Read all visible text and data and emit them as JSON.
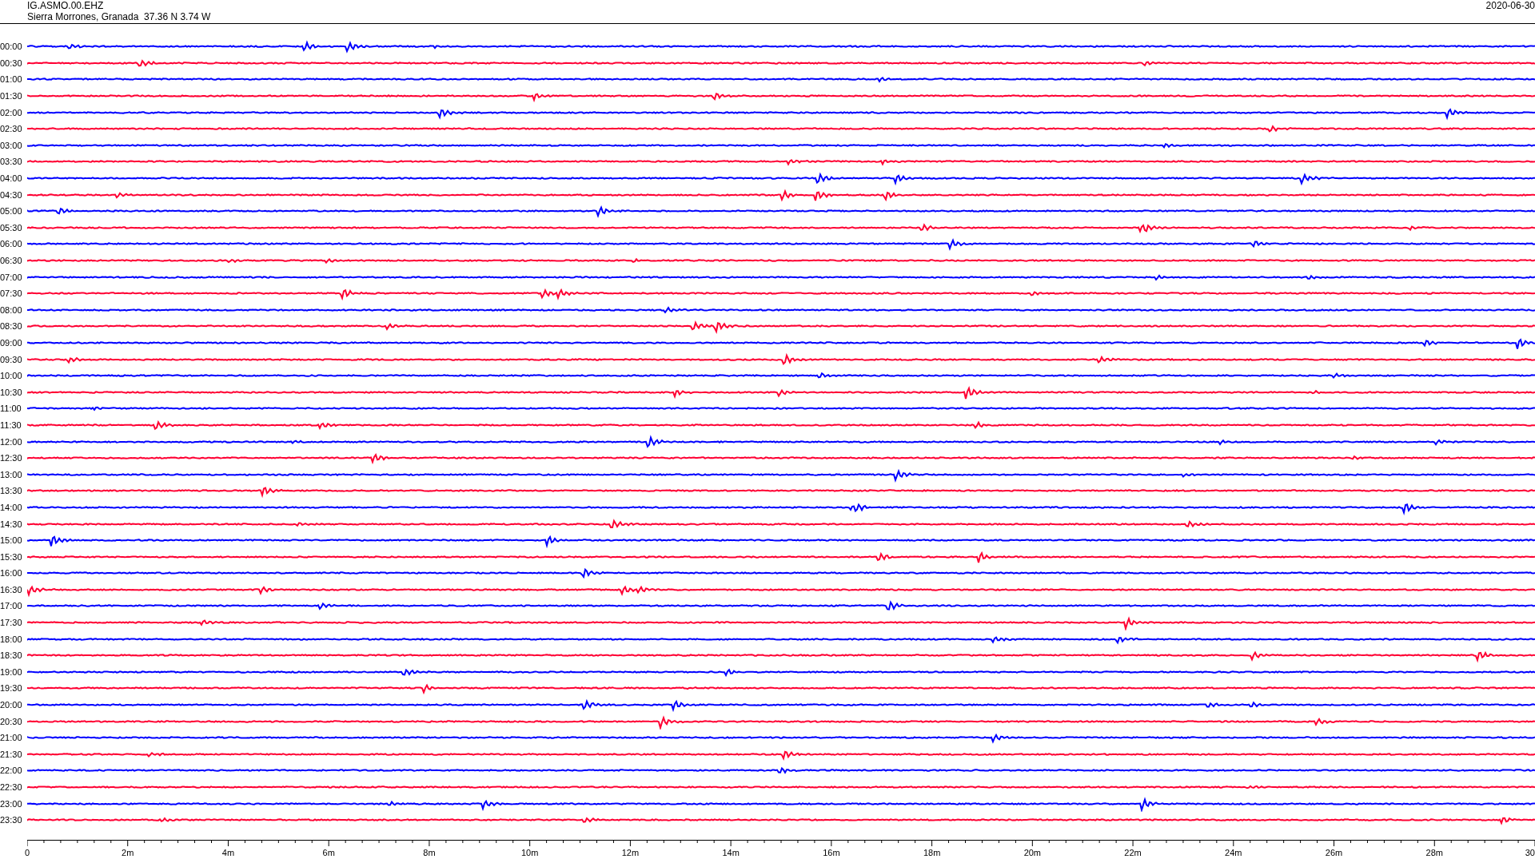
{
  "header": {
    "station": "IG.ASMO.00.EHZ",
    "location": "Sierra Morrones, Granada  37.36 N 3.74 W",
    "date": "2020-06-30"
  },
  "rows": [
    {
      "time": "00:00",
      "color": "#0000ff"
    },
    {
      "time": "00:30",
      "color": "#ff0033"
    },
    {
      "time": "01:00",
      "color": "#0000ff"
    },
    {
      "time": "01:30",
      "color": "#ff0033"
    },
    {
      "time": "02:00",
      "color": "#0000ff"
    },
    {
      "time": "02:30",
      "color": "#ff0033"
    },
    {
      "time": "03:00",
      "color": "#0000ff"
    },
    {
      "time": "03:30",
      "color": "#ff0033"
    },
    {
      "time": "04:00",
      "color": "#0000ff"
    },
    {
      "time": "04:30",
      "color": "#ff0033"
    },
    {
      "time": "05:00",
      "color": "#0000ff"
    },
    {
      "time": "05:30",
      "color": "#ff0033"
    },
    {
      "time": "06:00",
      "color": "#0000ff"
    },
    {
      "time": "06:30",
      "color": "#ff0033"
    },
    {
      "time": "07:00",
      "color": "#0000ff"
    },
    {
      "time": "07:30",
      "color": "#ff0033"
    },
    {
      "time": "08:00",
      "color": "#0000ff"
    },
    {
      "time": "08:30",
      "color": "#ff0033"
    },
    {
      "time": "09:00",
      "color": "#0000ff"
    },
    {
      "time": "09:30",
      "color": "#ff0033"
    },
    {
      "time": "10:00",
      "color": "#0000ff"
    },
    {
      "time": "10:30",
      "color": "#ff0033"
    },
    {
      "time": "11:00",
      "color": "#0000ff"
    },
    {
      "time": "11:30",
      "color": "#ff0033"
    },
    {
      "time": "12:00",
      "color": "#0000ff"
    },
    {
      "time": "12:30",
      "color": "#ff0033"
    },
    {
      "time": "13:00",
      "color": "#0000ff"
    },
    {
      "time": "13:30",
      "color": "#ff0033"
    },
    {
      "time": "14:00",
      "color": "#0000ff"
    },
    {
      "time": "14:30",
      "color": "#ff0033"
    },
    {
      "time": "15:00",
      "color": "#0000ff"
    },
    {
      "time": "15:30",
      "color": "#ff0033"
    },
    {
      "time": "16:00",
      "color": "#0000ff"
    },
    {
      "time": "16:30",
      "color": "#ff0033"
    },
    {
      "time": "17:00",
      "color": "#0000ff"
    },
    {
      "time": "17:30",
      "color": "#ff0033"
    },
    {
      "time": "18:00",
      "color": "#0000ff"
    },
    {
      "time": "18:30",
      "color": "#ff0033"
    },
    {
      "time": "19:00",
      "color": "#0000ff"
    },
    {
      "time": "19:30",
      "color": "#ff0033"
    },
    {
      "time": "20:00",
      "color": "#0000ff"
    },
    {
      "time": "20:30",
      "color": "#ff0033"
    },
    {
      "time": "21:00",
      "color": "#0000ff"
    },
    {
      "time": "21:30",
      "color": "#ff0033"
    },
    {
      "time": "22:00",
      "color": "#0000ff"
    },
    {
      "time": "22:30",
      "color": "#ff0033"
    },
    {
      "time": "23:00",
      "color": "#0000ff"
    },
    {
      "time": "23:30",
      "color": "#ff0033"
    }
  ],
  "x_axis": {
    "ticks": [
      "0",
      "2m",
      "4m",
      "6m",
      "8m",
      "10m",
      "12m",
      "14m",
      "16m",
      "18m",
      "20m",
      "22m",
      "24m",
      "26m",
      "28m",
      "30"
    ]
  }
}
